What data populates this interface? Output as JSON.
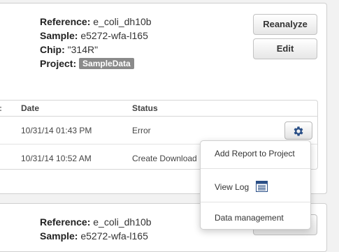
{
  "result1": {
    "reference_label": "Reference:",
    "reference_value": "e_coli_dh10b",
    "sample_label": "Sample:",
    "sample_value": "e5272-wfa-l165",
    "chip_label": "Chip:",
    "chip_value": "\"314R\"",
    "project_label": "Project:",
    "project_tag": "SampleData",
    "reanalyze_label": "Reanalyze",
    "edit_label": "Edit",
    "table": {
      "columns": [
        "Date",
        "Status"
      ],
      "rows": [
        {
          "date": "10/31/14 01:43 PM",
          "status": "Error"
        },
        {
          "date": "10/31/14 10:52 AM",
          "status": "Create Download"
        }
      ]
    }
  },
  "actions_menu": {
    "items": [
      "Add Report to Project",
      "View Log",
      "Data management"
    ]
  },
  "result2": {
    "reference_label": "Reference:",
    "reference_value": "e_coli_dh10b",
    "sample_label": "Sample:",
    "sample_value": "e5272-wfa-l165"
  },
  "colors": {
    "gear_icon": "#2a4f87",
    "tag_bg": "#8a8a8a",
    "calendar_icon": "#2a4f87"
  },
  "icons": [
    "gear-icon",
    "calendar-icon"
  ]
}
